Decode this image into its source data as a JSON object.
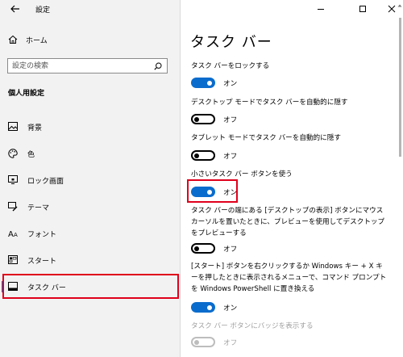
{
  "window": {
    "app_title": "設定"
  },
  "sidebar": {
    "home_label": "ホーム",
    "search_placeholder": "設定の検索",
    "section_title": "個人用設定",
    "items": [
      {
        "label": "背景",
        "icon": "picture-icon"
      },
      {
        "label": "色",
        "icon": "palette-icon"
      },
      {
        "label": "ロック画面",
        "icon": "lock-screen-icon"
      },
      {
        "label": "テーマ",
        "icon": "theme-brush-icon"
      },
      {
        "label": "フォント",
        "icon": "font-icon"
      },
      {
        "label": "スタート",
        "icon": "start-icon"
      },
      {
        "label": "タスク バー",
        "icon": "taskbar-icon",
        "selected": true
      }
    ]
  },
  "main": {
    "title": "タスク バー",
    "settings": [
      {
        "label": "タスク バーをロックする",
        "state": "オン",
        "on": true
      },
      {
        "label": "デスクトップ モードでタスク バーを自動的に隠す",
        "state": "オフ",
        "on": false
      },
      {
        "label": "タブレット モードでタスク バーを自動的に隠す",
        "state": "オフ",
        "on": false
      },
      {
        "label": "小さいタスク バー ボタンを使う",
        "state": "オン",
        "on": true
      },
      {
        "label": "タスク バーの端にある [デスクトップの表示] ボタンにマウス カーソルを置いたときに、プレビューを使用してデスクトップをプレビューする",
        "state": "オフ",
        "on": false
      },
      {
        "label": "[スタート] ボタンを右クリックするか Windows キー + X キーを押したときに表示されるメニューで、コマンド プロンプトを Windows PowerShell に置き換える",
        "state": "オン",
        "on": true
      },
      {
        "label": "タスク バー ボタンにバッジを表示する",
        "state": "オフ",
        "on": false,
        "disabled": true
      }
    ]
  },
  "colors": {
    "accent": "#0a6ccd",
    "highlight_box": "#e0001b",
    "sidebar_bg": "#f2f2f2"
  }
}
